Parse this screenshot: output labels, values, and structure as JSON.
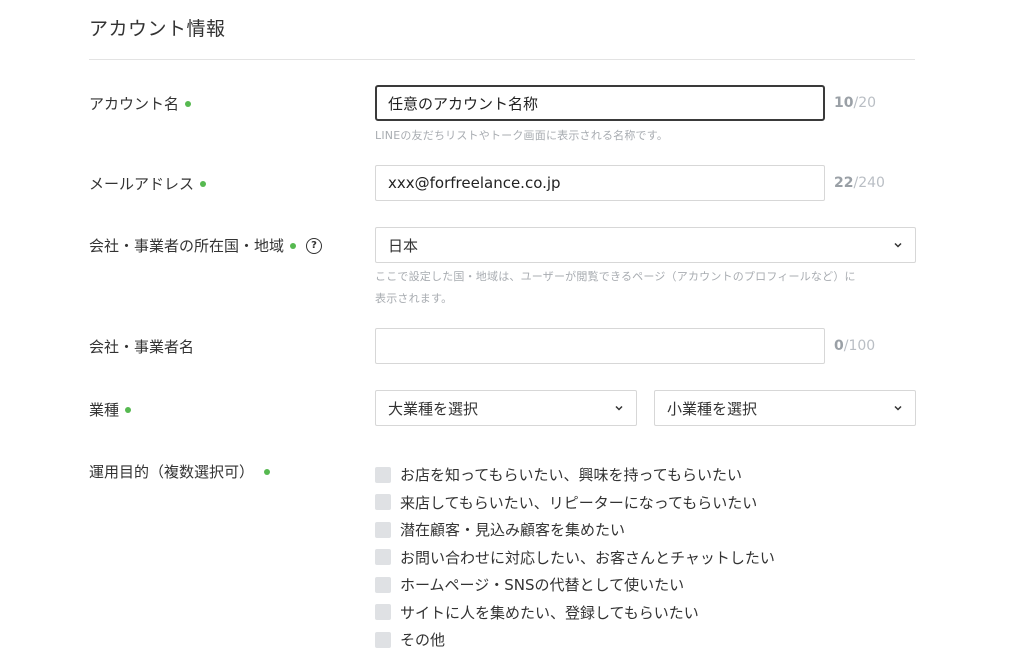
{
  "section_title": "アカウント情報",
  "account_name": {
    "label": "アカウント名",
    "value": "任意のアカウント名称",
    "counter_current": "10",
    "counter_max": "/20",
    "hint": "LINEの友だちリストやトーク画面に表示される名称です。"
  },
  "email": {
    "label": "メールアドレス",
    "value": "xxx@forfreelance.co.jp",
    "counter_current": "22",
    "counter_max": "/240"
  },
  "country": {
    "label": "会社・事業者の所在国・地域",
    "help_glyph": "?",
    "value": "日本",
    "hint_line1": "ここで設定した国・地域は、ユーザーが閲覧できるページ（アカウントのプロフィールなど）に",
    "hint_line2": "表示されます。"
  },
  "company": {
    "label": "会社・事業者名",
    "value": "",
    "counter_current": "0",
    "counter_max": "/100"
  },
  "industry": {
    "label": "業種",
    "major_placeholder": "大業種を選択",
    "minor_placeholder": "小業種を選択"
  },
  "purpose": {
    "label": "運用目的（複数選択可）",
    "options": [
      "お店を知ってもらいたい、興味を持ってもらいたい",
      "来店してもらいたい、リピーターになってもらいたい",
      "潜在顧客・見込み顧客を集めたい",
      "お問い合わせに対応したい、お客さんとチャットしたい",
      "ホームページ・SNSの代替として使いたい",
      "サイトに人を集めたい、登録してもらいたい",
      "その他"
    ]
  },
  "colors": {
    "required_dot": "#56b950",
    "focus_border": "#3a3a3a",
    "checkbox": "#dfe1e4"
  }
}
